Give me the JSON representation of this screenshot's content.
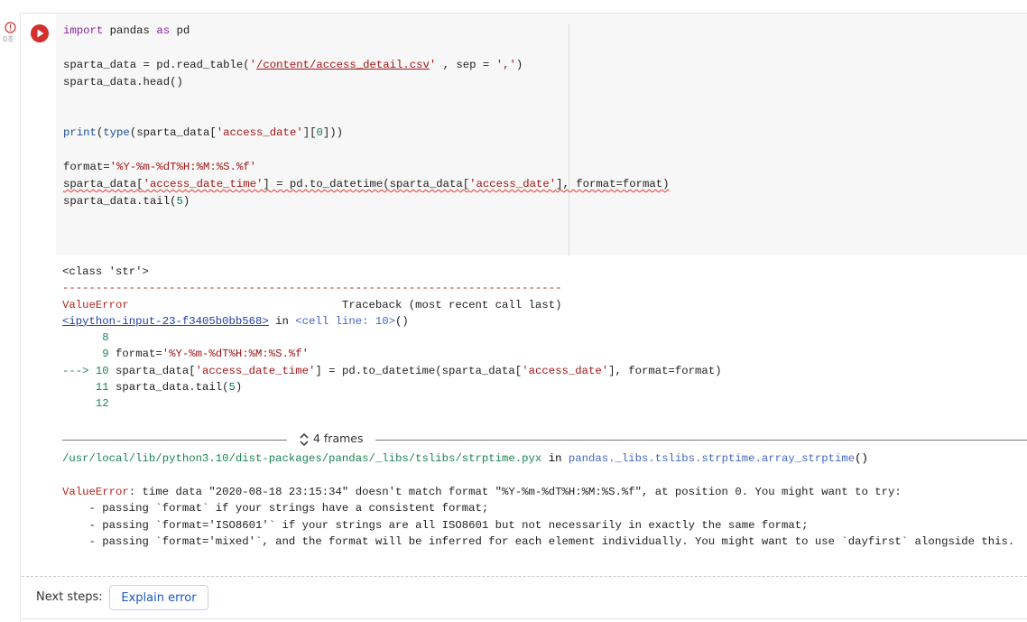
{
  "gutter": {
    "exec_time": "0초"
  },
  "code_lines": [
    [
      {
        "t": "import",
        "c": "kw"
      },
      {
        "t": " pandas "
      },
      {
        "t": "as",
        "c": "kw"
      },
      {
        "t": " pd"
      }
    ],
    [],
    [
      {
        "t": "sparta_data = pd.read_table("
      },
      {
        "t": "'",
        "c": "str"
      },
      {
        "t": "/content/access_detail.csv",
        "c": "str ul"
      },
      {
        "t": "'",
        "c": "str"
      },
      {
        "t": " , sep = "
      },
      {
        "t": "','",
        "c": "str"
      },
      {
        "t": ")"
      }
    ],
    [
      {
        "t": "sparta_data.head()"
      }
    ],
    [],
    [],
    [
      {
        "t": "print",
        "c": "fn"
      },
      {
        "t": "("
      },
      {
        "t": "type",
        "c": "fn"
      },
      {
        "t": "(sparta_data["
      },
      {
        "t": "'access_date'",
        "c": "str"
      },
      {
        "t": "]["
      },
      {
        "t": "0",
        "c": "num"
      },
      {
        "t": "]))"
      }
    ],
    [],
    [
      {
        "t": "format="
      },
      {
        "t": "'%Y-%m-%dT%H:%M:%S.%f'",
        "c": "str"
      }
    ],
    [
      {
        "t": "sparta_data[",
        "c": "squig"
      },
      {
        "t": "'access_date_time'",
        "c": "str squig"
      },
      {
        "t": "] = pd.to_datetime(sparta_data[",
        "c": "squig"
      },
      {
        "t": "'access_date'",
        "c": "str squig"
      },
      {
        "t": "], format=format)",
        "c": "squig"
      }
    ],
    [
      {
        "t": "sparta_data.tail("
      },
      {
        "t": "5",
        "c": "num"
      },
      {
        "t": ")"
      }
    ]
  ],
  "output_lines": [
    [
      {
        "t": "<class 'str'>"
      }
    ],
    [
      {
        "t": "---------------------------------------------------------------------------",
        "c": "red"
      }
    ],
    [
      {
        "t": "ValueError",
        "c": "red"
      },
      {
        "t": "                                Traceback (most recent call last)"
      }
    ],
    [
      {
        "t": "<ipython-input-23-f3405b0bb568>",
        "c": "link"
      },
      {
        "t": " in "
      },
      {
        "t": "<cell line: 10>",
        "c": "blue2"
      },
      {
        "t": "()"
      }
    ],
    [
      {
        "t": "      "
      },
      {
        "t": "8",
        "c": "green"
      }
    ],
    [
      {
        "t": "      "
      },
      {
        "t": "9",
        "c": "green"
      },
      {
        "t": " format="
      },
      {
        "t": "'%Y-%m-%dT%H:%M:%S.%f'",
        "c": "str"
      }
    ],
    [
      {
        "t": "---> 10",
        "c": "green"
      },
      {
        "t": " sparta_data["
      },
      {
        "t": "'access_date_time'",
        "c": "str"
      },
      {
        "t": "] = pd.to_datetime(sparta_data["
      },
      {
        "t": "'access_date'",
        "c": "str"
      },
      {
        "t": "], format=format)"
      }
    ],
    [
      {
        "t": "     "
      },
      {
        "t": "11",
        "c": "green"
      },
      {
        "t": " sparta_data.tail("
      },
      {
        "t": "5",
        "c": "num"
      },
      {
        "t": ")"
      }
    ],
    [
      {
        "t": "     "
      },
      {
        "t": "12",
        "c": "green"
      }
    ]
  ],
  "frames": {
    "label": "4 frames"
  },
  "trace_path": [
    {
      "t": "/usr/local/lib/python3.10/dist-packages/pandas/_libs/tslibs/strptime.pyx",
      "c": "green"
    },
    {
      "t": " in "
    },
    {
      "t": "pandas._libs.tslibs.strptime.array_strptime",
      "c": "blue2"
    },
    {
      "t": "()"
    }
  ],
  "error_lines": [
    [
      {
        "t": "ValueError",
        "c": "red"
      },
      {
        "t": ": time data \"2020-08-18 23:15:34\" doesn't match format \"%Y-%m-%dT%H:%M:%S.%f\", at position 0. You might want to try:"
      }
    ],
    [
      {
        "t": "    - passing `format` if your strings have a consistent format;"
      }
    ],
    [
      {
        "t": "    - passing `format='ISO8601'` if your strings are all ISO8601 but not necessarily in exactly the same format;"
      }
    ],
    [
      {
        "t": "    - passing `format='mixed'`, and the format will be inferred for each element individually. You might want to use `dayfirst` alongside this."
      }
    ]
  ],
  "next_steps": {
    "label": "Next steps:",
    "explain_button": "Explain error"
  },
  "colors": {
    "run_button": "#d32f2f",
    "error_red": "#b3261e",
    "link_blue": "#1a56c6"
  }
}
